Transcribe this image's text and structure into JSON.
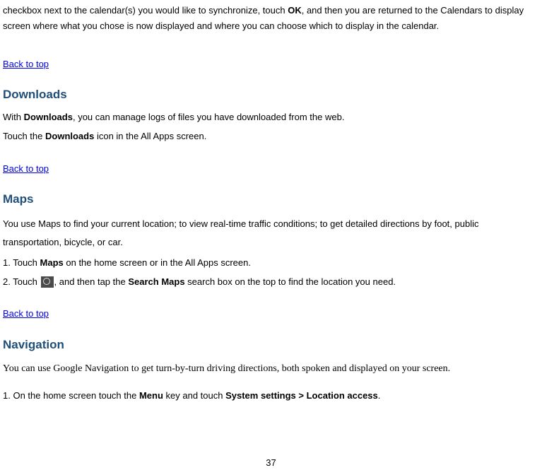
{
  "intro": {
    "p1a": "checkbox next to the calendar(s) you would like to synchronize, touch ",
    "p1bold": "OK",
    "p1b": ", and then you are returned to the Calendars to display screen where what you chose is now displayed and where you can choose which to display in the calendar."
  },
  "back": "Back to top",
  "downloads": {
    "heading": "Downloads",
    "p1a": "With ",
    "p1bold": "Downloads",
    "p1b": ", you can manage logs of files you have downloaded from the web.",
    "p2a": "Touch the ",
    "p2bold": "Downloads",
    "p2b": " icon in the All Apps screen."
  },
  "maps": {
    "heading": "Maps",
    "p1": "You use Maps to find your current location; to view real-time traffic conditions; to get detailed directions by foot, public transportation, bicycle, or car.",
    "s1a": "1. Touch ",
    "s1bold": "Maps",
    "s1b": " on the home screen or in the All Apps screen.",
    "s2a": "2. Touch ",
    "s2b": ", and then tap the ",
    "s2bold": "Search Maps",
    "s2c": " search box on the top to find the location you need."
  },
  "navigation": {
    "heading": "Navigation",
    "note": "You can use Google Navigation to get turn-by-turn driving directions, both spoken and displayed on your screen.",
    "s1a": "1. On the home screen touch the ",
    "s1bold1": "Menu",
    "s1b": " key and touch ",
    "s1bold2": "System settings > Location access",
    "s1c": "."
  },
  "pageNum": "37"
}
